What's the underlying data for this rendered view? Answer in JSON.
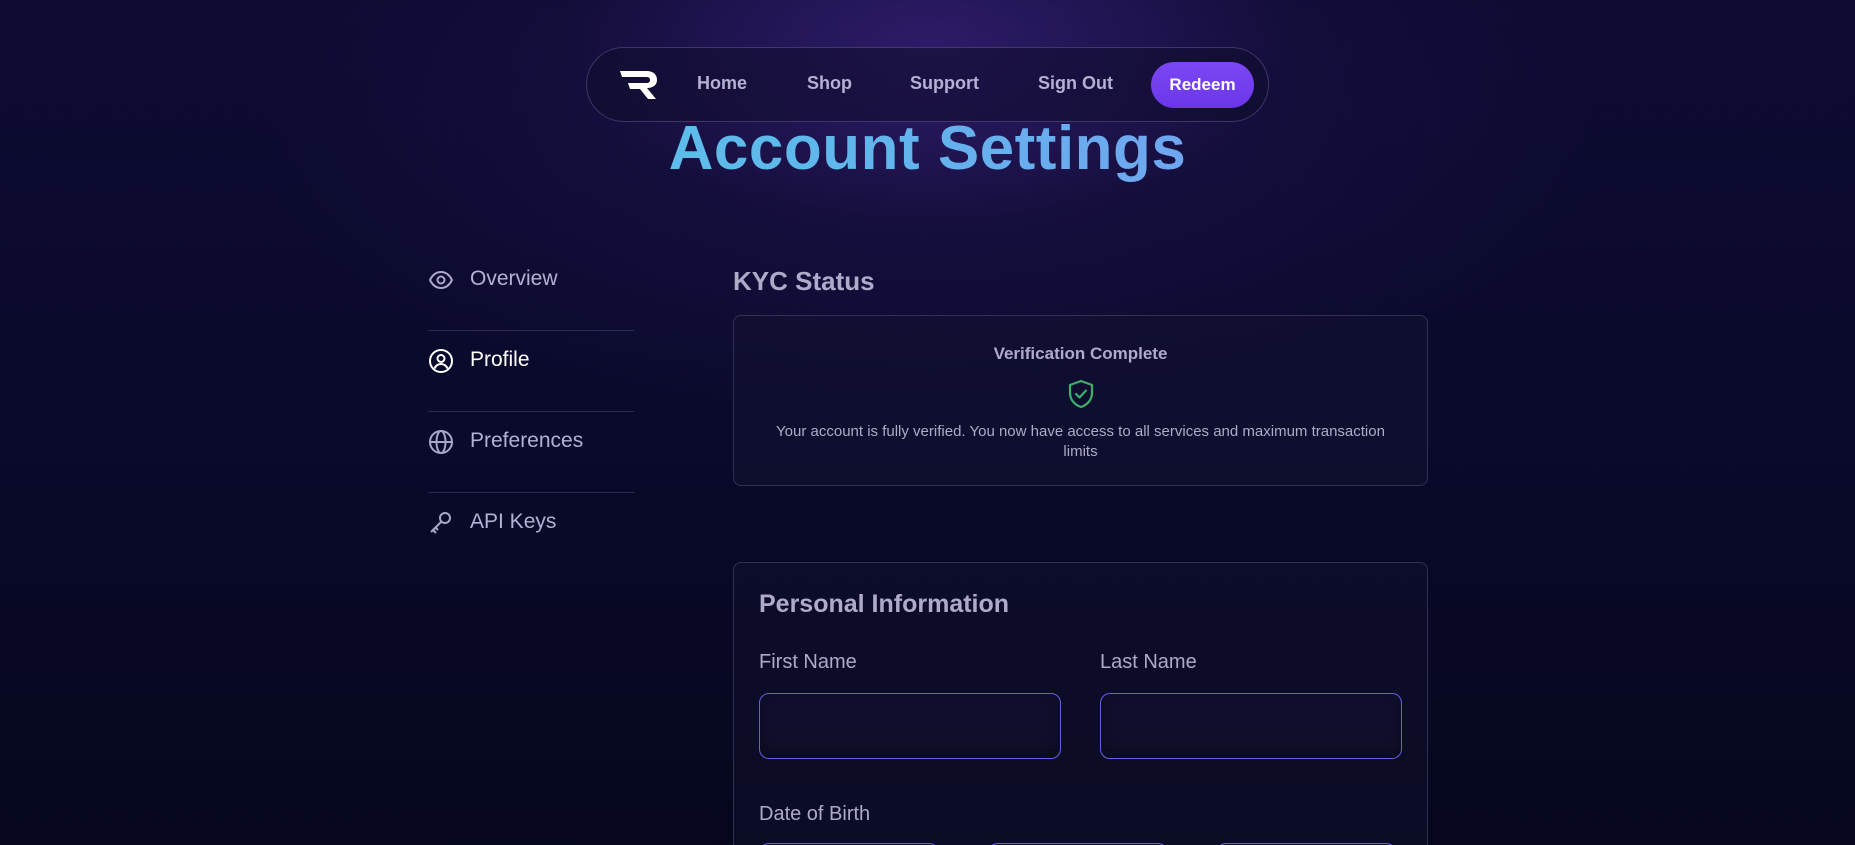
{
  "nav": {
    "logo_name": "R-logo",
    "links": [
      "Home",
      "Shop",
      "Support",
      "Sign Out"
    ],
    "redeem_label": "Redeem"
  },
  "page": {
    "title": "Account Settings"
  },
  "sidebar": {
    "items": [
      {
        "label": "Overview",
        "icon": "eye-icon",
        "active": false
      },
      {
        "label": "Profile",
        "icon": "user-circle-icon",
        "active": true
      },
      {
        "label": "Preferences",
        "icon": "globe-icon",
        "active": false
      },
      {
        "label": "API Keys",
        "icon": "key-icon",
        "active": false
      }
    ]
  },
  "kyc": {
    "section_title": "KYC Status",
    "heading": "Verification Complete",
    "status_icon": "shield-check-icon",
    "status_color": "#3fae6a",
    "description": "Your account is fully verified. You now have access to all services and maximum transaction limits"
  },
  "personal_info": {
    "title": "Personal Information",
    "first_name_label": "First Name",
    "first_name_value": "",
    "last_name_label": "Last Name",
    "last_name_value": "",
    "dob_label": "Date of Birth"
  },
  "colors": {
    "accent": "#7c48f5",
    "title_gradient_start": "#58d2e0",
    "title_gradient_end": "#8f86f5",
    "input_border": "#6a5ee0"
  }
}
